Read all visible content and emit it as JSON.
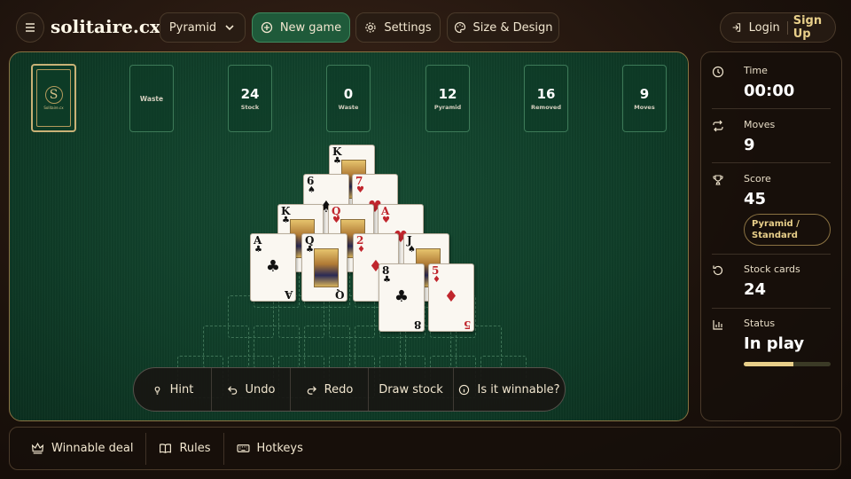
{
  "header": {
    "logo": "solitaire.cx",
    "game_select": "Pyramid",
    "new_game": "New game",
    "settings": "Settings",
    "size_design": "Size & Design",
    "login": "Login",
    "signup": "Sign Up"
  },
  "board": {
    "deck_monogram": "S",
    "deck_brand": "Solitaire.cx",
    "waste_slot_label": "Waste",
    "counters": [
      {
        "value": "24",
        "label": "Stock"
      },
      {
        "value": "0",
        "label": "Waste"
      },
      {
        "value": "12",
        "label": "Pyramid"
      },
      {
        "value": "16",
        "label": "Removed"
      },
      {
        "value": "9",
        "label": "Moves"
      }
    ],
    "cards": [
      {
        "rank": "K",
        "suit": "♣",
        "color": "blk",
        "face": true
      },
      {
        "rank": "6",
        "suit": "♠",
        "color": "blk",
        "face": false
      },
      {
        "rank": "7",
        "suit": "♥",
        "color": "red",
        "face": false
      },
      {
        "rank": "K",
        "suit": "♣",
        "color": "blk",
        "face": true
      },
      {
        "rank": "Q",
        "suit": "♥",
        "color": "red",
        "face": true
      },
      {
        "rank": "A",
        "suit": "♥",
        "color": "red",
        "face": false
      },
      {
        "rank": "J",
        "suit": "♠",
        "color": "blk",
        "face": true
      },
      {
        "rank": "2",
        "suit": "♦",
        "color": "red",
        "face": false
      },
      {
        "rank": "A",
        "suit": "♣",
        "color": "blk",
        "face": false
      },
      {
        "rank": "Q",
        "suit": "♣",
        "color": "blk",
        "face": true
      },
      {
        "rank": "8",
        "suit": "♣",
        "color": "blk",
        "face": false
      },
      {
        "rank": "5",
        "suit": "♦",
        "color": "red",
        "face": false
      }
    ]
  },
  "controls": {
    "hint": "Hint",
    "undo": "Undo",
    "redo": "Redo",
    "draw_stock": "Draw stock",
    "winnable": "Is it winnable?"
  },
  "sidebar": {
    "time_label": "Time",
    "time_value": "00:00",
    "moves_label": "Moves",
    "moves_value": "9",
    "score_label": "Score",
    "score_value": "45",
    "mode_line1": "Pyramid /",
    "mode_line2": "Standard",
    "stock_label": "Stock cards",
    "stock_value": "24",
    "status_label": "Status",
    "status_value": "In play",
    "status_progress": 0.57
  },
  "footer": {
    "winnable_deal": "Winnable deal",
    "rules": "Rules",
    "hotkeys": "Hotkeys"
  },
  "colors": {
    "felt": "#0f3d28",
    "gold": "#c9b277",
    "new_game_bg": "#1f5a3a",
    "red_suit": "#c0262d"
  }
}
